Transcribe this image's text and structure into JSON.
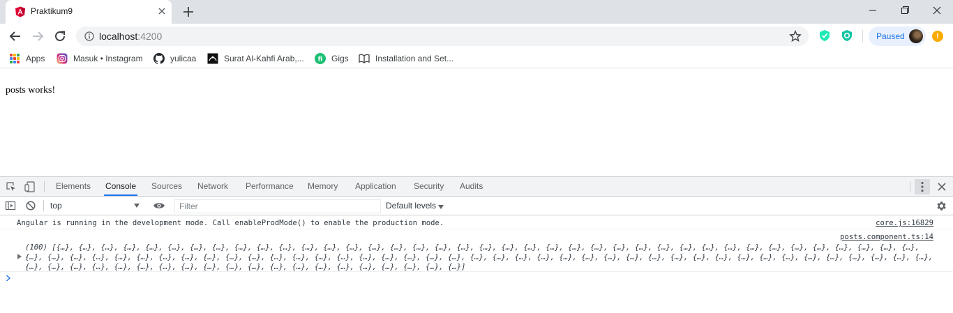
{
  "tab": {
    "title": "Praktikum9",
    "favicon": "angular-icon"
  },
  "toolbar": {
    "url_host": "localhost",
    "url_port": ":4200",
    "profile_label": "Paused",
    "update_badge": "!"
  },
  "bookmarks": [
    {
      "label": "Apps",
      "icon": "apps-grid-icon"
    },
    {
      "label": "Masuk • Instagram",
      "icon": "instagram-icon"
    },
    {
      "label": "yulicaa",
      "icon": "github-icon"
    },
    {
      "label": "Surat Al-Kahfi Arab,...",
      "icon": "quran-icon"
    },
    {
      "label": "Gigs",
      "icon": "fiverr-icon"
    },
    {
      "label": "Installation and Set...",
      "icon": "book-icon"
    }
  ],
  "page": {
    "text": "posts works!"
  },
  "devtools": {
    "tabs": [
      "Elements",
      "Console",
      "Sources",
      "Network",
      "Performance",
      "Memory",
      "Application",
      "Security",
      "Audits"
    ],
    "active_tab": "Console",
    "context": "top",
    "filter_placeholder": "Filter",
    "levels": "Default levels",
    "logs": [
      {
        "message": "Angular is running in the development mode. Call enableProdMode() to enable the production mode.",
        "source": "core.js:16829"
      },
      {
        "source": "posts.component.ts:14",
        "count_label": "(100)",
        "item_text": "{…}",
        "item_count": 100
      }
    ]
  }
}
